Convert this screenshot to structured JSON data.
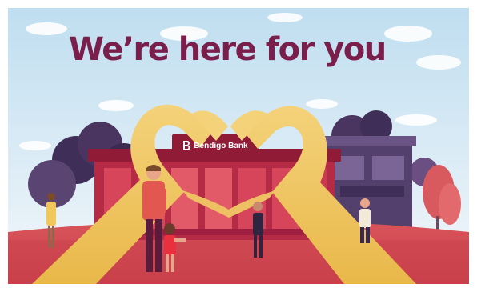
{
  "headline": "We’re here for you",
  "bank_sign": {
    "name": "Bendigo Bank",
    "logo": "bendigo-b-logo"
  },
  "colors": {
    "headline": "#7a1f4b",
    "sky_top": "#c9e3f2",
    "sky_bottom": "#f2f6f9",
    "ground": "#d44b4f",
    "bank_red": "#9e1f3f",
    "hands": "#f1c75b",
    "trees": "#4a3560"
  }
}
